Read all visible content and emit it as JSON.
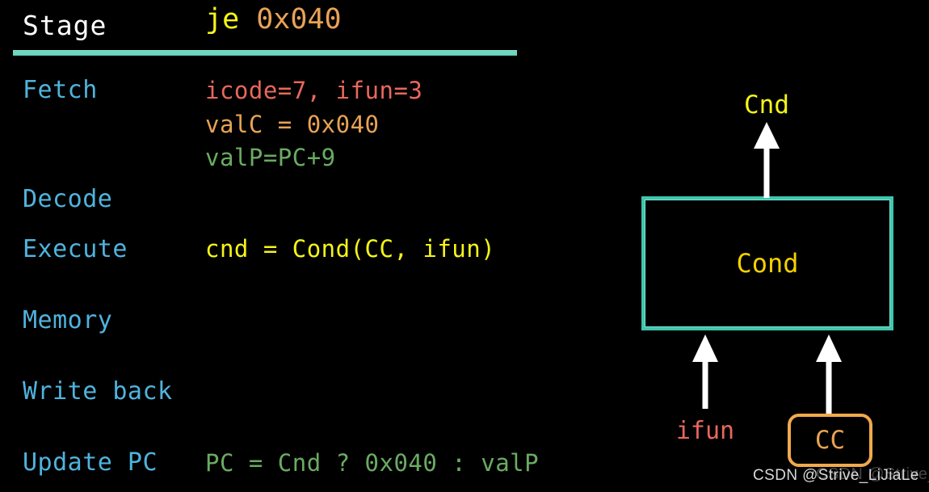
{
  "slide": {
    "background_color": "#000000",
    "accent_teal": "#3fc6ae",
    "accent_orange": "#f0a94c",
    "accent_yellow": "#f5f518",
    "stage_label_color": "#4fb3dd"
  },
  "table": {
    "header": {
      "stage_column": "Stage",
      "instruction_op": "je",
      "instruction_arg": "0x040"
    },
    "rows": [
      {
        "stage": "Fetch",
        "lines": [
          {
            "text": "icode=7, ifun=3",
            "color": "#e8685c"
          },
          {
            "text": "valC = 0x040",
            "color": "#e8a255"
          },
          {
            "text": "valP=PC+9",
            "color": "#6aab62"
          }
        ]
      },
      {
        "stage": "Decode",
        "lines": []
      },
      {
        "stage": "Execute",
        "lines": [
          {
            "text": "cnd = Cond(CC, ifun)",
            "color": "#f5f518"
          }
        ]
      },
      {
        "stage": "Memory",
        "lines": []
      },
      {
        "stage": "Write back",
        "lines": []
      },
      {
        "stage": "Update PC",
        "lines": [
          {
            "text": "PC = Cnd ? 0x040 : valP",
            "color": "#6aab62"
          }
        ]
      }
    ]
  },
  "diagram": {
    "output_label": "Cnd",
    "unit_label": "Cond",
    "input_left_label": "ifun",
    "input_right_box_label": "CC",
    "arrow_up_output": "arrow-up-icon",
    "arrow_up_ifun": "arrow-up-icon",
    "arrow_up_cc": "arrow-up-icon"
  },
  "watermark": {
    "text": "CSDN @Strive_LiJiaLe",
    "ghost_text": "CSDN @Strive_LiJiaLe"
  }
}
